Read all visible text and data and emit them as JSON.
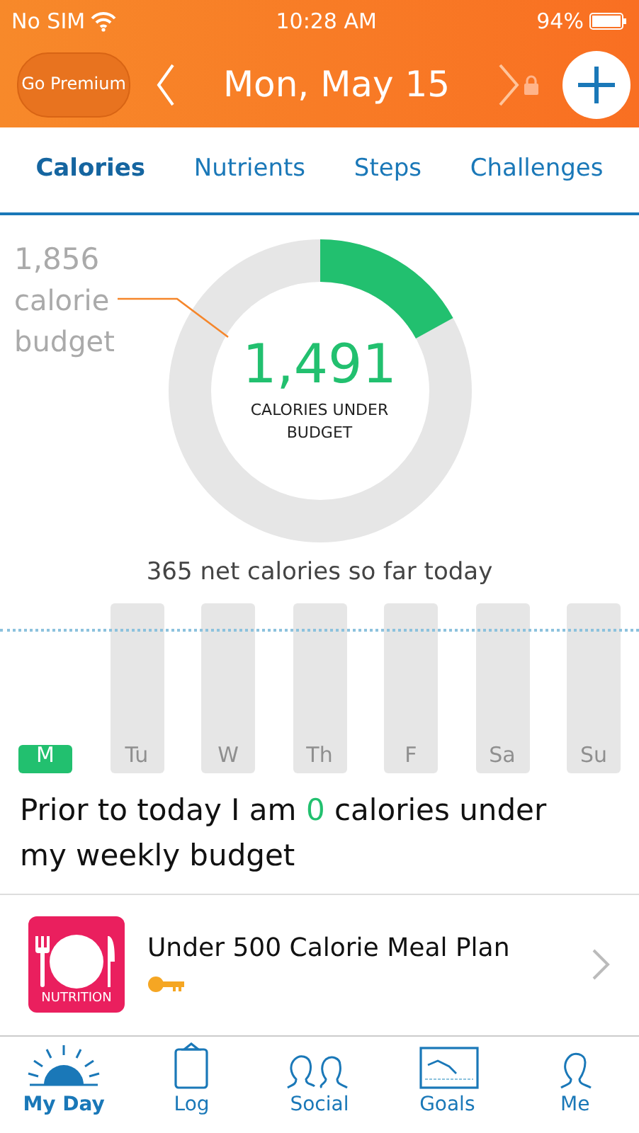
{
  "status_bar": {
    "carrier": "No SIM",
    "time": "10:28 AM",
    "battery": "94%"
  },
  "header": {
    "premium_button": "Go Premium",
    "date": "Mon, May 15",
    "next_locked": true
  },
  "tabs": [
    {
      "label": "Calories",
      "selected": true
    },
    {
      "label": "Nutrients",
      "selected": false
    },
    {
      "label": "Steps",
      "selected": false
    },
    {
      "label": "Challenges",
      "selected": false
    }
  ],
  "summary": {
    "budget_value": "1,856",
    "budget_label": "calorie budget",
    "level": 0.17,
    "remaining_value": "1,491",
    "remaining_label": "CALORIES UNDER BUDGET",
    "net_caption": "365 net calories so far today"
  },
  "week": [
    {
      "day": "M",
      "current": true
    },
    {
      "day": "Tu",
      "current": false
    },
    {
      "day": "W",
      "current": false
    },
    {
      "day": "Th",
      "current": false
    },
    {
      "day": "F",
      "current": false
    },
    {
      "day": "Sa",
      "current": false
    },
    {
      "day": "Su",
      "current": false
    }
  ],
  "weekly_prefix": "Prior to today I am",
  "weekly_value": "0",
  "weekly_suffix": "calories under my weekly budget",
  "promo": {
    "badge": "NUTRITION",
    "title": "Under 500 Calorie Meal Plan",
    "locked": true
  },
  "nav": [
    {
      "label": "My Day",
      "selected": true,
      "kind": "sun"
    },
    {
      "label": "Log",
      "selected": false,
      "kind": "clipboard"
    },
    {
      "label": "Social",
      "selected": false,
      "kind": "people"
    },
    {
      "label": "Goals",
      "selected": false,
      "kind": "chart"
    },
    {
      "label": "Me",
      "selected": false,
      "kind": "person"
    }
  ]
}
